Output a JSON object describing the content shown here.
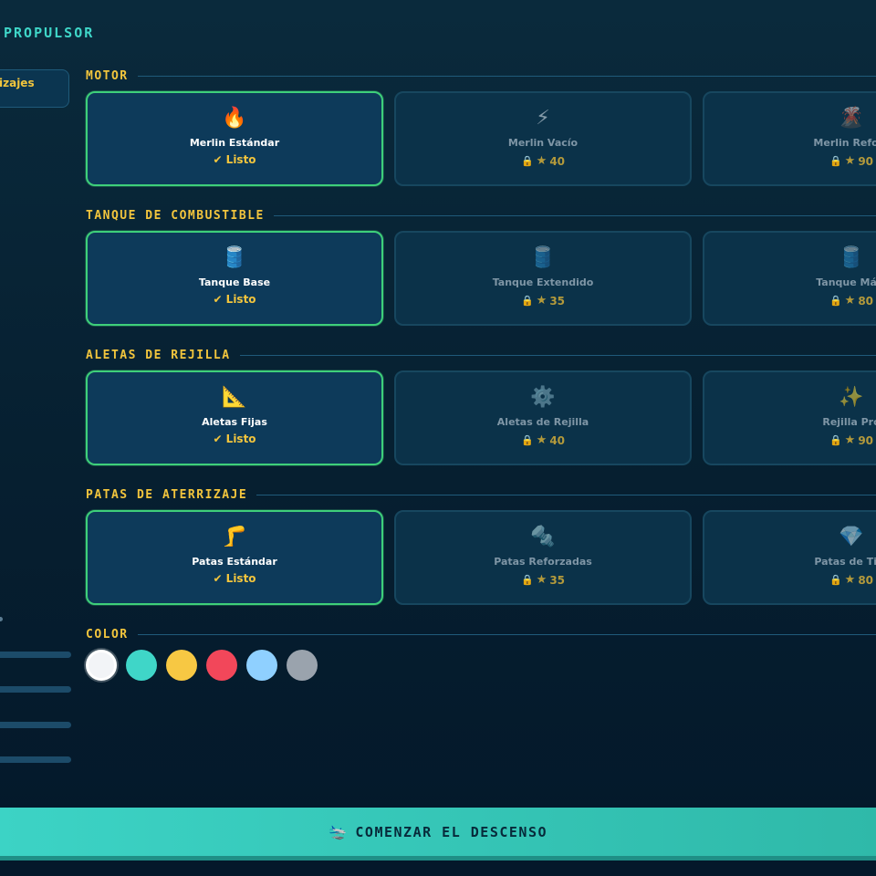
{
  "header": {
    "title": "PROPULSOR"
  },
  "sidebar": {
    "active_tab_label": "izajes"
  },
  "sections": [
    {
      "title": "MOTOR",
      "cards": [
        {
          "icon": "🔥",
          "icon_name": "flame-icon",
          "name": "Merlin Estándar",
          "status": "✔ Listo",
          "selected": true
        },
        {
          "icon": "⚡",
          "icon_name": "lightning-icon",
          "name": "Merlin Vacío",
          "cost": "40",
          "locked": true
        },
        {
          "icon": "🌋",
          "icon_name": "volcano-icon",
          "name": "Merlin Reforz",
          "cost": "90",
          "locked": true
        }
      ]
    },
    {
      "title": "TANQUE DE COMBUSTIBLE",
      "cards": [
        {
          "icon": "🛢️",
          "icon_name": "barrel-icon",
          "name": "Tanque Base",
          "status": "✔ Listo",
          "selected": true
        },
        {
          "icon": "🛢️",
          "icon_name": "barrel-icon",
          "name": "Tanque Extendido",
          "cost": "35",
          "locked": true
        },
        {
          "icon": "🛢️",
          "icon_name": "barrel-icon",
          "name": "Tanque Máxi",
          "cost": "80",
          "locked": true
        }
      ]
    },
    {
      "title": "ALETAS DE REJILLA",
      "cards": [
        {
          "icon": "📐",
          "icon_name": "triangle-ruler-icon",
          "name": "Aletas Fijas",
          "status": "✔ Listo",
          "selected": true
        },
        {
          "icon": "⚙️",
          "icon_name": "gear-icon",
          "name": "Aletas de Rejilla",
          "cost": "40",
          "locked": true
        },
        {
          "icon": "✨",
          "icon_name": "sparkles-icon",
          "name": "Rejilla Pro",
          "cost": "90",
          "locked": true
        }
      ]
    },
    {
      "title": "PATAS DE ATERRIZAJE",
      "cards": [
        {
          "icon": "🦵",
          "icon_name": "leg-icon",
          "name": "Patas Estándar",
          "status": "✔ Listo",
          "selected": true
        },
        {
          "icon": "🔩",
          "icon_name": "bolt-icon",
          "name": "Patas Reforzadas",
          "cost": "35",
          "locked": true
        },
        {
          "icon": "💎",
          "icon_name": "gem-icon",
          "name": "Patas de Tita",
          "cost": "80",
          "locked": true
        }
      ]
    }
  ],
  "color_section": {
    "title": "COLOR",
    "swatches": [
      {
        "hex": "#f2f4f7",
        "selected": true
      },
      {
        "hex": "#3fd6c8"
      },
      {
        "hex": "#f7c843"
      },
      {
        "hex": "#f2475a"
      },
      {
        "hex": "#8fd0ff"
      },
      {
        "hex": "#9aa3ad"
      }
    ]
  },
  "start_button": {
    "icon": "🛬",
    "label": "COMENZAR EL DESCENSO"
  },
  "colors": {
    "accent": "#3fd6c8",
    "gold": "#f2c53d",
    "selected_border": "#3ecf7a"
  }
}
